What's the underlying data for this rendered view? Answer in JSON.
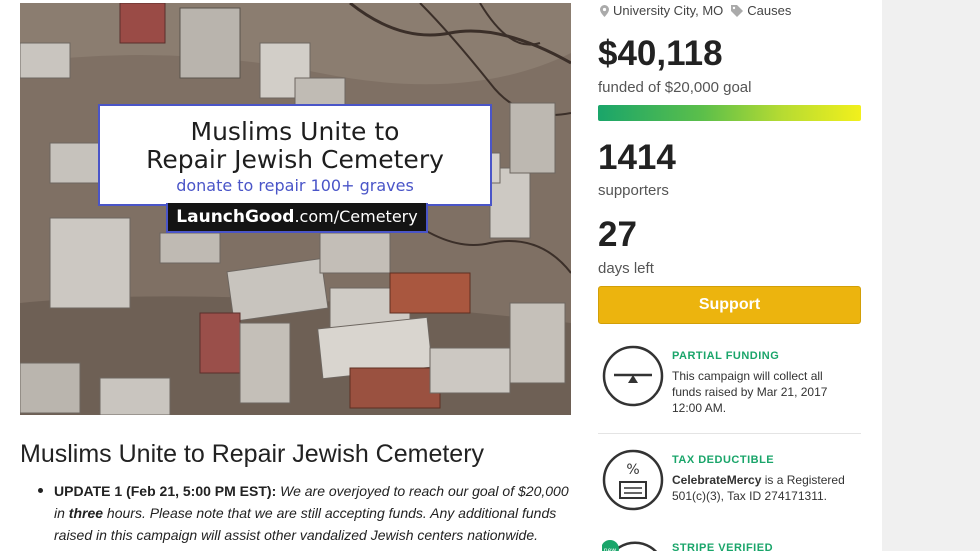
{
  "hero": {
    "banner_line1": "Muslims Unite to",
    "banner_line2": "Repair Jewish Cemetery",
    "banner_line3": "donate to repair 100+ graves",
    "tag_brand": "LaunchGood",
    "tag_path": ".com/Cemetery"
  },
  "campaign": {
    "title": "Muslims Unite to Repair Jewish Cemetery",
    "update_label": "UPDATE  1 (Feb 21, 5:00 PM EST):",
    "update_text_a": " We are overjoyed to reach our goal of $20,000 in ",
    "update_bold": "three",
    "update_text_b": " hours. Please note that we are still accepting funds. Any additional funds raised in this campaign will assist other vandalized Jewish centers nationwide."
  },
  "sidebar": {
    "location": "University City, MO",
    "category": "Causes",
    "amount": "$40,118",
    "goal_text": "funded of $20,000 goal",
    "funded_fraction": 1.0,
    "supporters_count": "1414",
    "supporters_label": "supporters",
    "days_count": "27",
    "days_label": "days left",
    "support_button": "Support",
    "features": [
      {
        "title": "PARTIAL FUNDING",
        "body": "This campaign will collect all funds raised by Mar 21, 2017 12:00 AM."
      },
      {
        "title": "TAX DEDUCTIBLE",
        "org": "CelebrateMercy",
        "body": " is a Registered 501(c)(3), Tax ID 274171311."
      },
      {
        "title": "STRIPE VERIFIED",
        "badge": "new"
      }
    ]
  },
  "colors": {
    "accent_green": "#1aa56a",
    "support_yellow": "#ecb40e",
    "banner_blue": "#4a55c8"
  }
}
